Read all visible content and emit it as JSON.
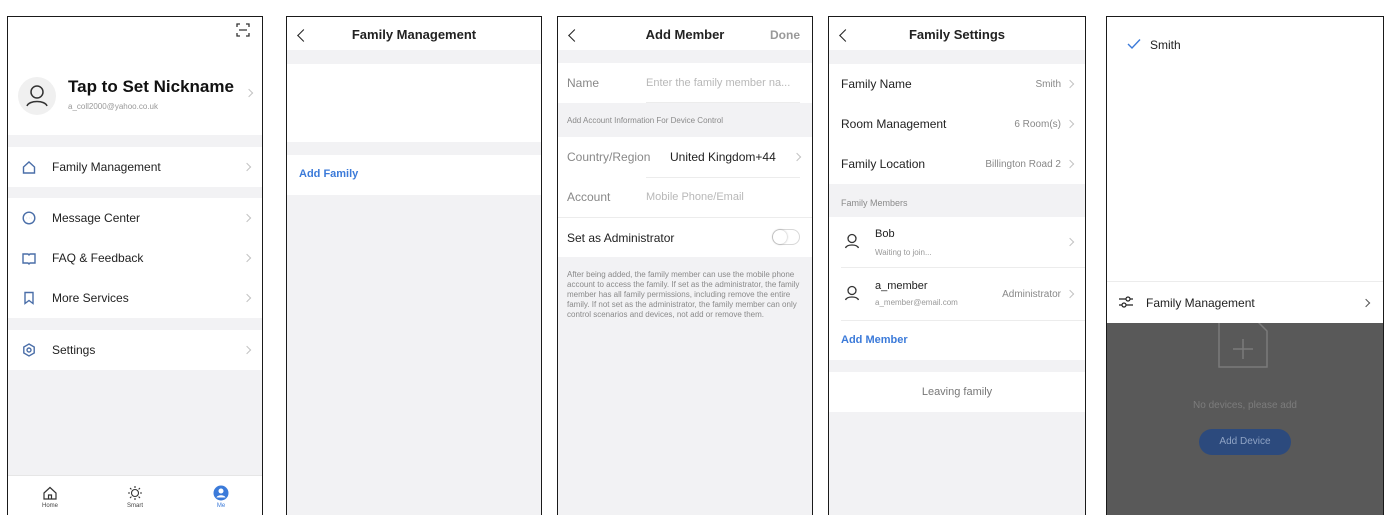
{
  "me_screen": {
    "nickname": "Tap to Set Nickname",
    "email": "a_coll2000@yahoo.co.uk",
    "menu": {
      "family_management": "Family Management",
      "message_center": "Message Center",
      "faq_feedback": "FAQ & Feedback",
      "more_services": "More Services",
      "settings": "Settings"
    },
    "tabs": {
      "home": "Home",
      "smart": "Smart",
      "me": "Me"
    }
  },
  "family_management_screen": {
    "title": "Family Management",
    "add_family": "Add Family"
  },
  "add_member_screen": {
    "title": "Add Member",
    "done": "Done",
    "name_label": "Name",
    "name_placeholder": "Enter the family member na...",
    "section_header": "Add Account Information For Device Control",
    "country_label": "Country/Region",
    "country_value": "United Kingdom+44",
    "account_label": "Account",
    "account_placeholder": "Mobile Phone/Email",
    "admin_label": "Set as Administrator",
    "admin_enabled": false,
    "note": "After being added, the family member can use the mobile phone account to access the family. If set as the administrator, the family member has all family permissions, including remove the entire family. If not set as the administrator, the family member can only control scenarios and devices, not add or remove them."
  },
  "family_settings_screen": {
    "title": "Family Settings",
    "family_name_label": "Family Name",
    "family_name_value": "Smith",
    "room_label": "Room Management",
    "room_value": "6 Room(s)",
    "location_label": "Family Location",
    "location_value": "Billington Road 2",
    "members_header": "Family Members",
    "members": [
      {
        "name": "Bob",
        "sub": "Waiting to join...",
        "role": ""
      },
      {
        "name": "a_member",
        "sub": "a_member@email.com",
        "role": "Administrator"
      }
    ],
    "add_member": "Add Member",
    "leave": "Leaving family"
  },
  "family_switcher_screen": {
    "family": "Smith",
    "family_management": "Family Management",
    "empty_text": "No devices, please add",
    "add_device": "Add Device"
  },
  "colors": {
    "accent": "#3b7ad9",
    "icon_blue": "#4a6ea8",
    "overlay": "#595959"
  }
}
